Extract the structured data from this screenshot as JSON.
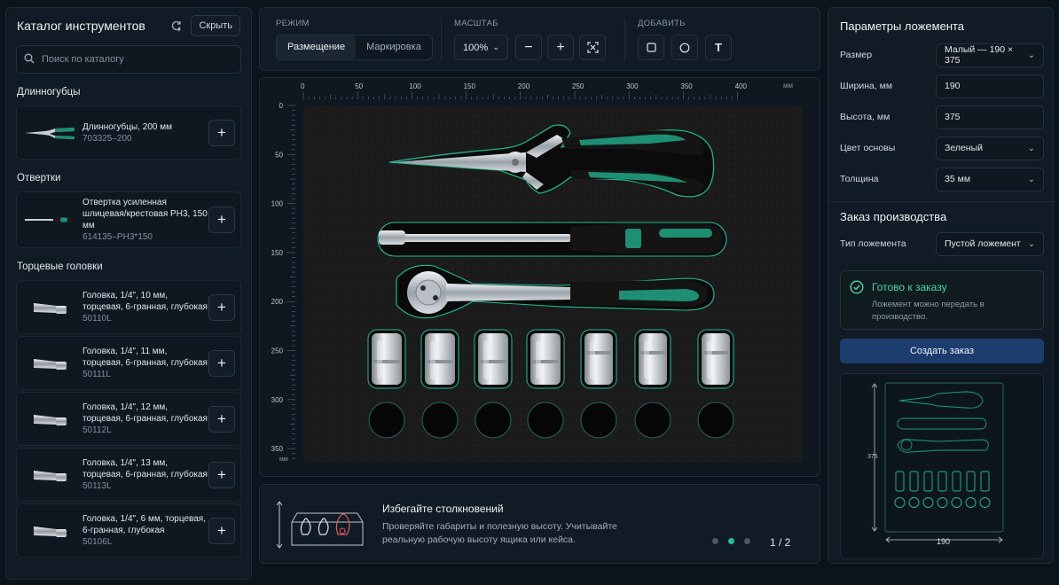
{
  "catalog": {
    "title": "Каталог инструментов",
    "hide_label": "Скрыть",
    "search_placeholder": "Поиск по каталогу",
    "groups": [
      {
        "title": "Длинногубцы",
        "items": [
          {
            "name": "Длинногубцы, 200 мм",
            "sku": "703325–200"
          }
        ]
      },
      {
        "title": "Отвертки",
        "items": [
          {
            "name": "Отвертка усиленная шлицевая/крестовая PH3, 150 мм",
            "sku": "614135–PH3*150"
          }
        ]
      },
      {
        "title": "Торцевые головки",
        "items": [
          {
            "name": "Головка, 1/4\", 10 мм, торцевая, 6-гранная, глубокая",
            "sku": "50110L"
          },
          {
            "name": "Головка, 1/4\", 11 мм, торцевая, 6-гранная, глубокая",
            "sku": "50111L"
          },
          {
            "name": "Головка, 1/4\", 12 мм, торцевая, 6-гранная, глубокая",
            "sku": "50112L"
          },
          {
            "name": "Головка, 1/4\", 13 мм, торцевая, 6-гранная, глубокая",
            "sku": "50113L"
          },
          {
            "name": "Головка, 1/4\", 6 мм, торцевая, 6-гранная, глубокая",
            "sku": "50106L"
          }
        ]
      }
    ]
  },
  "toolbar": {
    "mode_label": "РЕЖИМ",
    "mode_placement": "Размещение",
    "mode_marking": "Маркировка",
    "scale_label": "МАСШТАБ",
    "zoom_value": "100%",
    "zoom_out": "−",
    "zoom_in": "+",
    "add_label": "ДОБАВИТЬ",
    "text_tool": "T"
  },
  "canvas": {
    "ruler_unit": "мм",
    "x_ticks": [
      "0",
      "50",
      "100",
      "150",
      "200",
      "250",
      "300",
      "350",
      "400"
    ],
    "y_ticks": [
      "0",
      "50",
      "100",
      "150",
      "200",
      "250",
      "300",
      "350"
    ],
    "tray_color": "#1a1a1a",
    "accent_color": "#1fbf91"
  },
  "tip": {
    "title": "Избегайте столкновений",
    "text": "Проверяйте габариты и полезную высоту. Учитывайте реальную рабочую высоту ящика или кейса.",
    "page": "1 / 2",
    "active_dot": 2
  },
  "params": {
    "title": "Параметры ложемента",
    "size_label": "Размер",
    "size_value": "Малый — 190 × 375",
    "width_label": "Ширина, мм",
    "width_value": "190",
    "height_label": "Высота, мм",
    "height_value": "375",
    "color_label": "Цвет основы",
    "color_value": "Зеленый",
    "thickness_label": "Толщина",
    "thickness_value": "35 мм"
  },
  "order": {
    "title": "Заказ производства",
    "type_label": "Тип ложемента",
    "type_value": "Пустой ложемент",
    "ready_title": "Готово к заказу",
    "ready_text": "Ложемент можно передать в производство.",
    "button": "Создать заказ",
    "preview_height": "375",
    "preview_width": "190"
  }
}
